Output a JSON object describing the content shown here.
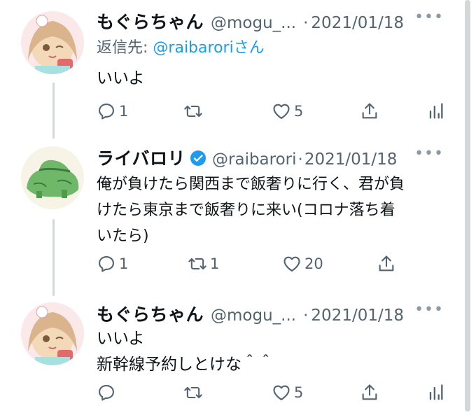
{
  "tweets": [
    {
      "name": "もぐらちゃん",
      "handle": "@mogu_...",
      "date": "2021/01/18",
      "reply_prefix": "返信先:",
      "reply_to": "@raibarori",
      "reply_suffix": "さん",
      "text": "いいよ",
      "reply_count": "1",
      "retweet_count": "",
      "like_count": "5"
    },
    {
      "name": "ライバロリ",
      "handle": "@raibarori",
      "date": "2021/01/18",
      "text": "俺が負けたら関西まで飯奢りに行く、君が負\nけたら東京まで飯奢りに来い(コロナ落ち着\nいたら)",
      "reply_count": "1",
      "retweet_count": "1",
      "like_count": "20"
    },
    {
      "name": "もぐらちゃん",
      "handle": "@mogu_...",
      "date": "2021/01/18",
      "text": "いいよ\n新幹線予約しとけな＾＾",
      "reply_count": "",
      "retweet_count": "",
      "like_count": "5"
    }
  ],
  "ui": {
    "more": "•••",
    "dot": "·"
  },
  "colors": {
    "text": "#0f1419",
    "secondary": "#536471",
    "link": "#1d9bf0",
    "verified": "#1d9bf0",
    "thread_line": "#cfd9de"
  }
}
